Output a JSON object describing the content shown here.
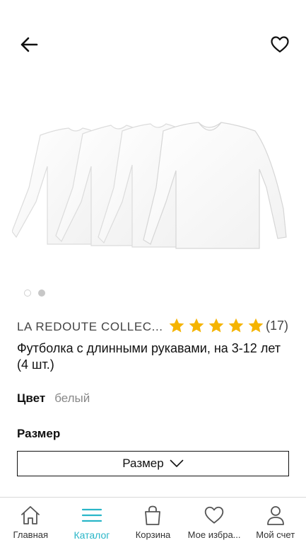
{
  "header": {
    "back_icon": "arrow-left-icon",
    "favorite_icon": "heart-outline-icon"
  },
  "gallery": {
    "image_count": 2,
    "active_index": 1,
    "image_description_icon": "product-photo-white-longsleeves"
  },
  "product": {
    "brand": "LA REDOUTE COLLEC...",
    "rating": 5,
    "rating_max": 5,
    "rating_count": "(17)",
    "title": "Футболка с длинными рукавами, на 3-12 лет (4 шт.)",
    "color_label": "Цвет",
    "color_value": "белый",
    "size_label": "Размер",
    "size_select_label": "Размер"
  },
  "colors": {
    "star": "#f5b400",
    "accent": "#29b6c8",
    "text_muted": "#888888"
  },
  "bottom_nav": {
    "items": [
      {
        "label": "Главная",
        "icon": "home-icon",
        "active": false
      },
      {
        "label": "Каталог",
        "icon": "menu-icon",
        "active": true
      },
      {
        "label": "Корзина",
        "icon": "bag-icon",
        "active": false
      },
      {
        "label": "Мое избра...",
        "icon": "heart-icon",
        "active": false
      },
      {
        "label": "Мой счет",
        "icon": "user-icon",
        "active": false
      }
    ]
  }
}
